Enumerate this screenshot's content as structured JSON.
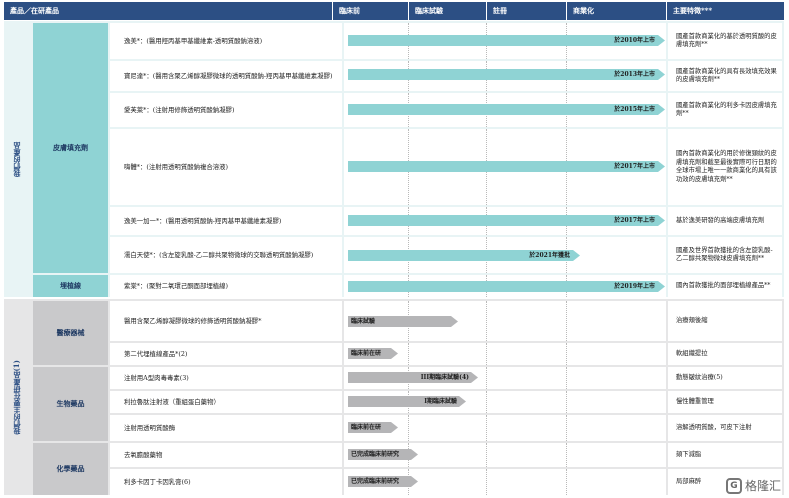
{
  "header": {
    "product": "產品／在研產品",
    "stages": [
      "臨床前",
      "臨床試驗",
      "註冊",
      "商業化"
    ],
    "features": "主要特徵***"
  },
  "groups": {
    "own": "我們的產品",
    "rd": "我們的主要在研產品(1)"
  },
  "categories": {
    "dermal": "皮膚填充劑",
    "thread": "埋植線",
    "device": "醫療器械",
    "bio": "生物藥品",
    "chem": "化學藥品"
  },
  "rows": [
    {
      "product": "逸美*：(醫用羥丙基甲基纖維素-透明質酸鈉溶液)",
      "arrow": "於2010年上市",
      "feature": "國產首款商業化的基於透明質酸的皮膚填充劑**"
    },
    {
      "product": "寶尼達*：(醫用含聚乙烯醇凝膠微球的透明質酸鈉-羥丙基甲基纖維素凝膠)",
      "arrow": "於2013年上市",
      "feature": "國產首款商業化的具有長效填充效果的皮膚填充劑**"
    },
    {
      "product": "愛芙萊*：(注射用修飾透明質酸鈉凝膠)",
      "arrow": "於2015年上市",
      "feature": "國產首款商業化的利多卡因皮膚填充劑**"
    },
    {
      "product": "嗨體*：(注射用透明質酸鈉複合溶液)",
      "arrow": "於2017年上市",
      "feature": "國內首款商業化的用於修復頸紋的皮膚填充劑和截至最後實際可行日期的全球市場上唯一一款商業化的具有該功效的皮膚填充劑**"
    },
    {
      "product": "逸美一加一*：(醫用透明質酸鈉-羥丙基甲基纖維素凝膠)",
      "arrow": "於2017年上市",
      "feature": "基於逸美研發的高端皮膚填充劑"
    },
    {
      "product": "濡白天使*：(含左旋乳酸-乙二醇共聚物微球的交聯透明質酸鈉凝膠)",
      "arrow": "於2021年獲批",
      "feature": "國產及世界首款獲批的含左旋乳酸-乙二醇共聚物微球皮膚填充劑**"
    },
    {
      "product": "紫棠*：(聚對二氧環己酮面部埋植線)",
      "arrow": "於2019年上市",
      "feature": "國內首款獲批的面部埋植線產品**"
    },
    {
      "product": "醫用含聚乙烯醇凝膠微球的修飾透明質酸鈉凝膠*",
      "arrow": "臨床試驗",
      "feature": "治療頰後縮"
    },
    {
      "product": "第二代埋植線產品*(2)",
      "arrow": "臨床前在研",
      "feature": "軟組織提拉"
    },
    {
      "product": "注射用A型肉毒毒素(3)",
      "arrow": "III期臨床試驗(4)",
      "feature": "動態皺紋治療(5)"
    },
    {
      "product": "利拉魯肽注射液（重組蛋白藥物）",
      "arrow": "I期臨床試驗",
      "feature": "慢性體重管理"
    },
    {
      "product": "注射用透明質酸酶",
      "arrow": "臨床前在研",
      "feature": "溶解透明質酸，可皮下注射"
    },
    {
      "product": "去氧膽酸藥物",
      "arrow": "已完成臨床前研究",
      "feature": "頦下減脂"
    },
    {
      "product": "利多卡因丁卡因乳膏(6)",
      "arrow": "已完成臨床前研究",
      "feature": "局部麻醉"
    }
  ],
  "watermark": "格隆汇",
  "colors": {
    "header": "#2c4f84",
    "teal": "#8fd3d4",
    "grey": "#b5b5b7"
  }
}
